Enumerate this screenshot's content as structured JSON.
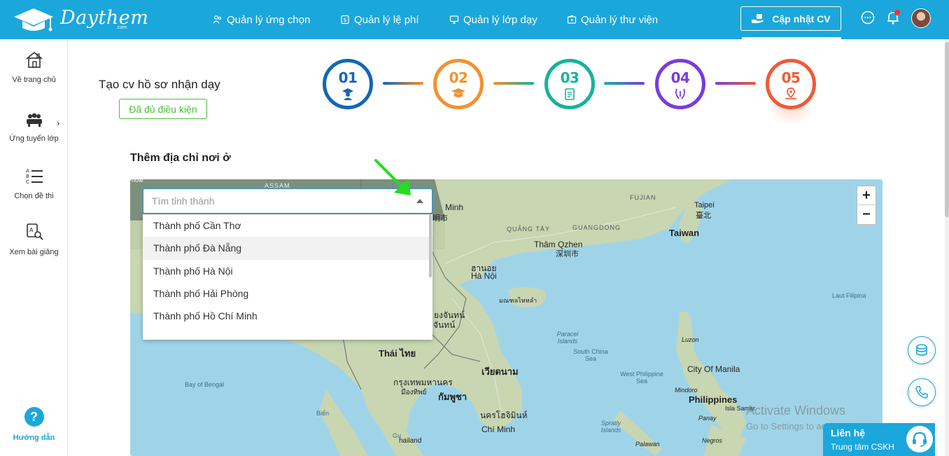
{
  "header": {
    "logo_text": "Daythem",
    "logo_sub": ".com",
    "nav": [
      {
        "label": "Quản lý ứng chọn",
        "icon": "users-icon"
      },
      {
        "label": "Quản lý lệ phí",
        "icon": "fee-icon"
      },
      {
        "label": "Quản lý lớp dạy",
        "icon": "classroom-icon"
      },
      {
        "label": "Quản lý thư viện",
        "icon": "library-icon"
      }
    ],
    "cv_button": "Cập nhật CV",
    "icons": [
      "chat-icon",
      "bell-icon",
      "avatar"
    ]
  },
  "sidebar": {
    "items": [
      {
        "label": "Về trang chủ",
        "icon": "home-icon"
      },
      {
        "label": "Ứng tuyển lớp",
        "icon": "group-icon"
      },
      {
        "label": "Chọn đề thi",
        "icon": "exam-list-icon"
      },
      {
        "label": "Xem bài giảng",
        "icon": "lesson-search-icon"
      }
    ],
    "help": {
      "symbol": "?",
      "label": "Hướng dẫn"
    }
  },
  "main": {
    "title": "Tạo cv hồ sơ nhận dạy",
    "status_badge": "Đã đủ điều kiện",
    "steps": [
      {
        "num": "01",
        "color": "#1466b8"
      },
      {
        "num": "02",
        "color": "#f3912e"
      },
      {
        "num": "03",
        "color": "#16b39a"
      },
      {
        "num": "04",
        "color": "#7a3be0"
      },
      {
        "num": "05",
        "color": "#f05a35"
      }
    ],
    "section_label": "Thêm địa chỉ nơi ở",
    "province_select": {
      "placeholder": "Tìm tỉnh thành",
      "options": [
        "Thành phố Cần Thơ",
        "Thành phố Đà Nẵng",
        "Thành phố Hà Nội",
        "Thành phố Hải Phòng",
        "Thành phố Hồ Chí Minh"
      ]
    },
    "map": {
      "zoom_in": "+",
      "zoom_out": "−",
      "labels": {
        "top_left_frag": "how",
        "assam": "ASSAM",
        "minh_frag": "Minh",
        "minh_frag2": "明市",
        "fujian": "FUJIAN",
        "taipei": "Taipei",
        "taipei_cn": "臺北",
        "taiwan": "Taiwan",
        "quang_tay": "QUẢNG TÂY",
        "guangdong": "GUANGDONG",
        "tham_qzhen": "Thâm Qzhen",
        "tham_cn": "深圳市",
        "hanoi_th": "ฮานอย",
        "hanoi": "Hà Nội",
        "hainan_th": "มณฑลไหหลำ",
        "laos_frag": "ยงจันทน์",
        "laos_frag2": "จันทน์",
        "thai": "Thái ไทย",
        "vietnam": "เวียดนาม",
        "bangkok_frag": "กรุงเทพมหานคร",
        "bangkok_frag2": "มืองทิพย์",
        "cambodia": "กัมพูชา",
        "hcm_th": "นครโฮจิมินห์",
        "hcm": "Chí Minh",
        "bay_of_bengal": "Bay of Bengal",
        "bien": "Biển",
        "gu": "Gu",
        "thailand_frag": "hailand",
        "paracel": "Paracel Islands",
        "scs": "South China Sea",
        "wps": "West Philippine Sea",
        "luzon": "Luzon",
        "manila": "City Of Manila",
        "mindoro": "Mindoro",
        "philippines": "Philippines",
        "panay": "Panay",
        "palawan": "Palawan",
        "negros": "Negros",
        "spratly": "Spratly Islands",
        "laut_filipina": "Laut Filipina",
        "isla_samar": "Isla Samar"
      },
      "watermark_title": "Activate Windows",
      "watermark_sub": "Go to Settings to activate Windows."
    }
  },
  "floating": {
    "contact_title": "Liên hệ",
    "contact_sub": "Trung tâm CSKH"
  }
}
